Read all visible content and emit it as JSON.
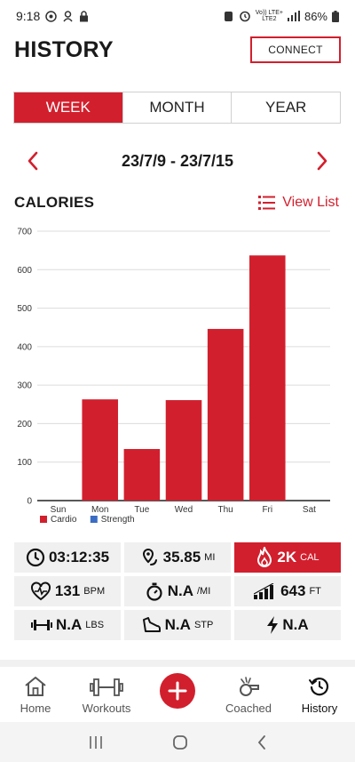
{
  "status": {
    "time": "9:18",
    "network_top": "Vo)) LTE+",
    "network_bottom": "LTE2",
    "battery": "86%"
  },
  "header": {
    "title": "HISTORY",
    "connect_label": "CONNECT"
  },
  "period_tabs": [
    {
      "label": "WEEK",
      "active": true
    },
    {
      "label": "MONTH",
      "active": false
    },
    {
      "label": "YEAR",
      "active": false
    }
  ],
  "date_range": "23/7/9 - 23/7/15",
  "calories": {
    "title": "CALORIES",
    "view_list_label": "View List"
  },
  "chart_data": {
    "type": "bar",
    "categories": [
      "Sun",
      "Mon",
      "Tue",
      "Wed",
      "Thu",
      "Fri",
      "Sat"
    ],
    "series": [
      {
        "name": "Cardio",
        "color": "#d21f2d",
        "values": [
          0,
          263,
          134,
          261,
          446,
          637,
          0
        ]
      },
      {
        "name": "Strength",
        "color": "#3b6cc4",
        "values": [
          0,
          0,
          0,
          0,
          0,
          0,
          0
        ]
      }
    ],
    "yticks": [
      0,
      100,
      200,
      300,
      400,
      500,
      600,
      700
    ],
    "ylim": [
      0,
      700
    ],
    "grid": true,
    "legend": "bottom-left"
  },
  "stats": {
    "duration": {
      "value": "03:12:35",
      "icon": "clock-icon"
    },
    "distance": {
      "value": "35.85",
      "unit": "MI",
      "icon": "route-pin-icon"
    },
    "calories": {
      "value": "2K",
      "unit": "CAL",
      "icon": "flame-icon",
      "active": true
    },
    "heart_rate": {
      "value": "131",
      "unit": "BPM",
      "icon": "heart-rate-icon"
    },
    "pace": {
      "value": "N.A",
      "unit": "/MI",
      "icon": "stopwatch-icon"
    },
    "elevation": {
      "value": "643",
      "unit": "FT",
      "icon": "elevation-icon"
    },
    "weight": {
      "value": "N.A",
      "unit": "LBS",
      "icon": "dumbbell-icon"
    },
    "steps": {
      "value": "N.A",
      "unit": "STP",
      "icon": "shoe-icon"
    },
    "power": {
      "value": "N.A",
      "unit": "",
      "icon": "bolt-icon"
    }
  },
  "bottom_nav": [
    {
      "label": "Home",
      "icon": "home-icon",
      "active": false
    },
    {
      "label": "Workouts",
      "icon": "dumbbell-icon",
      "active": false
    },
    {
      "label": "",
      "icon": "plus-icon",
      "active": false
    },
    {
      "label": "Coached",
      "icon": "whistle-icon",
      "active": false
    },
    {
      "label": "History",
      "icon": "history-clock-icon",
      "active": true
    }
  ],
  "colors": {
    "accent": "#d21f2d",
    "strength": "#3b6cc4",
    "tile_bg": "#f0f0f0"
  }
}
